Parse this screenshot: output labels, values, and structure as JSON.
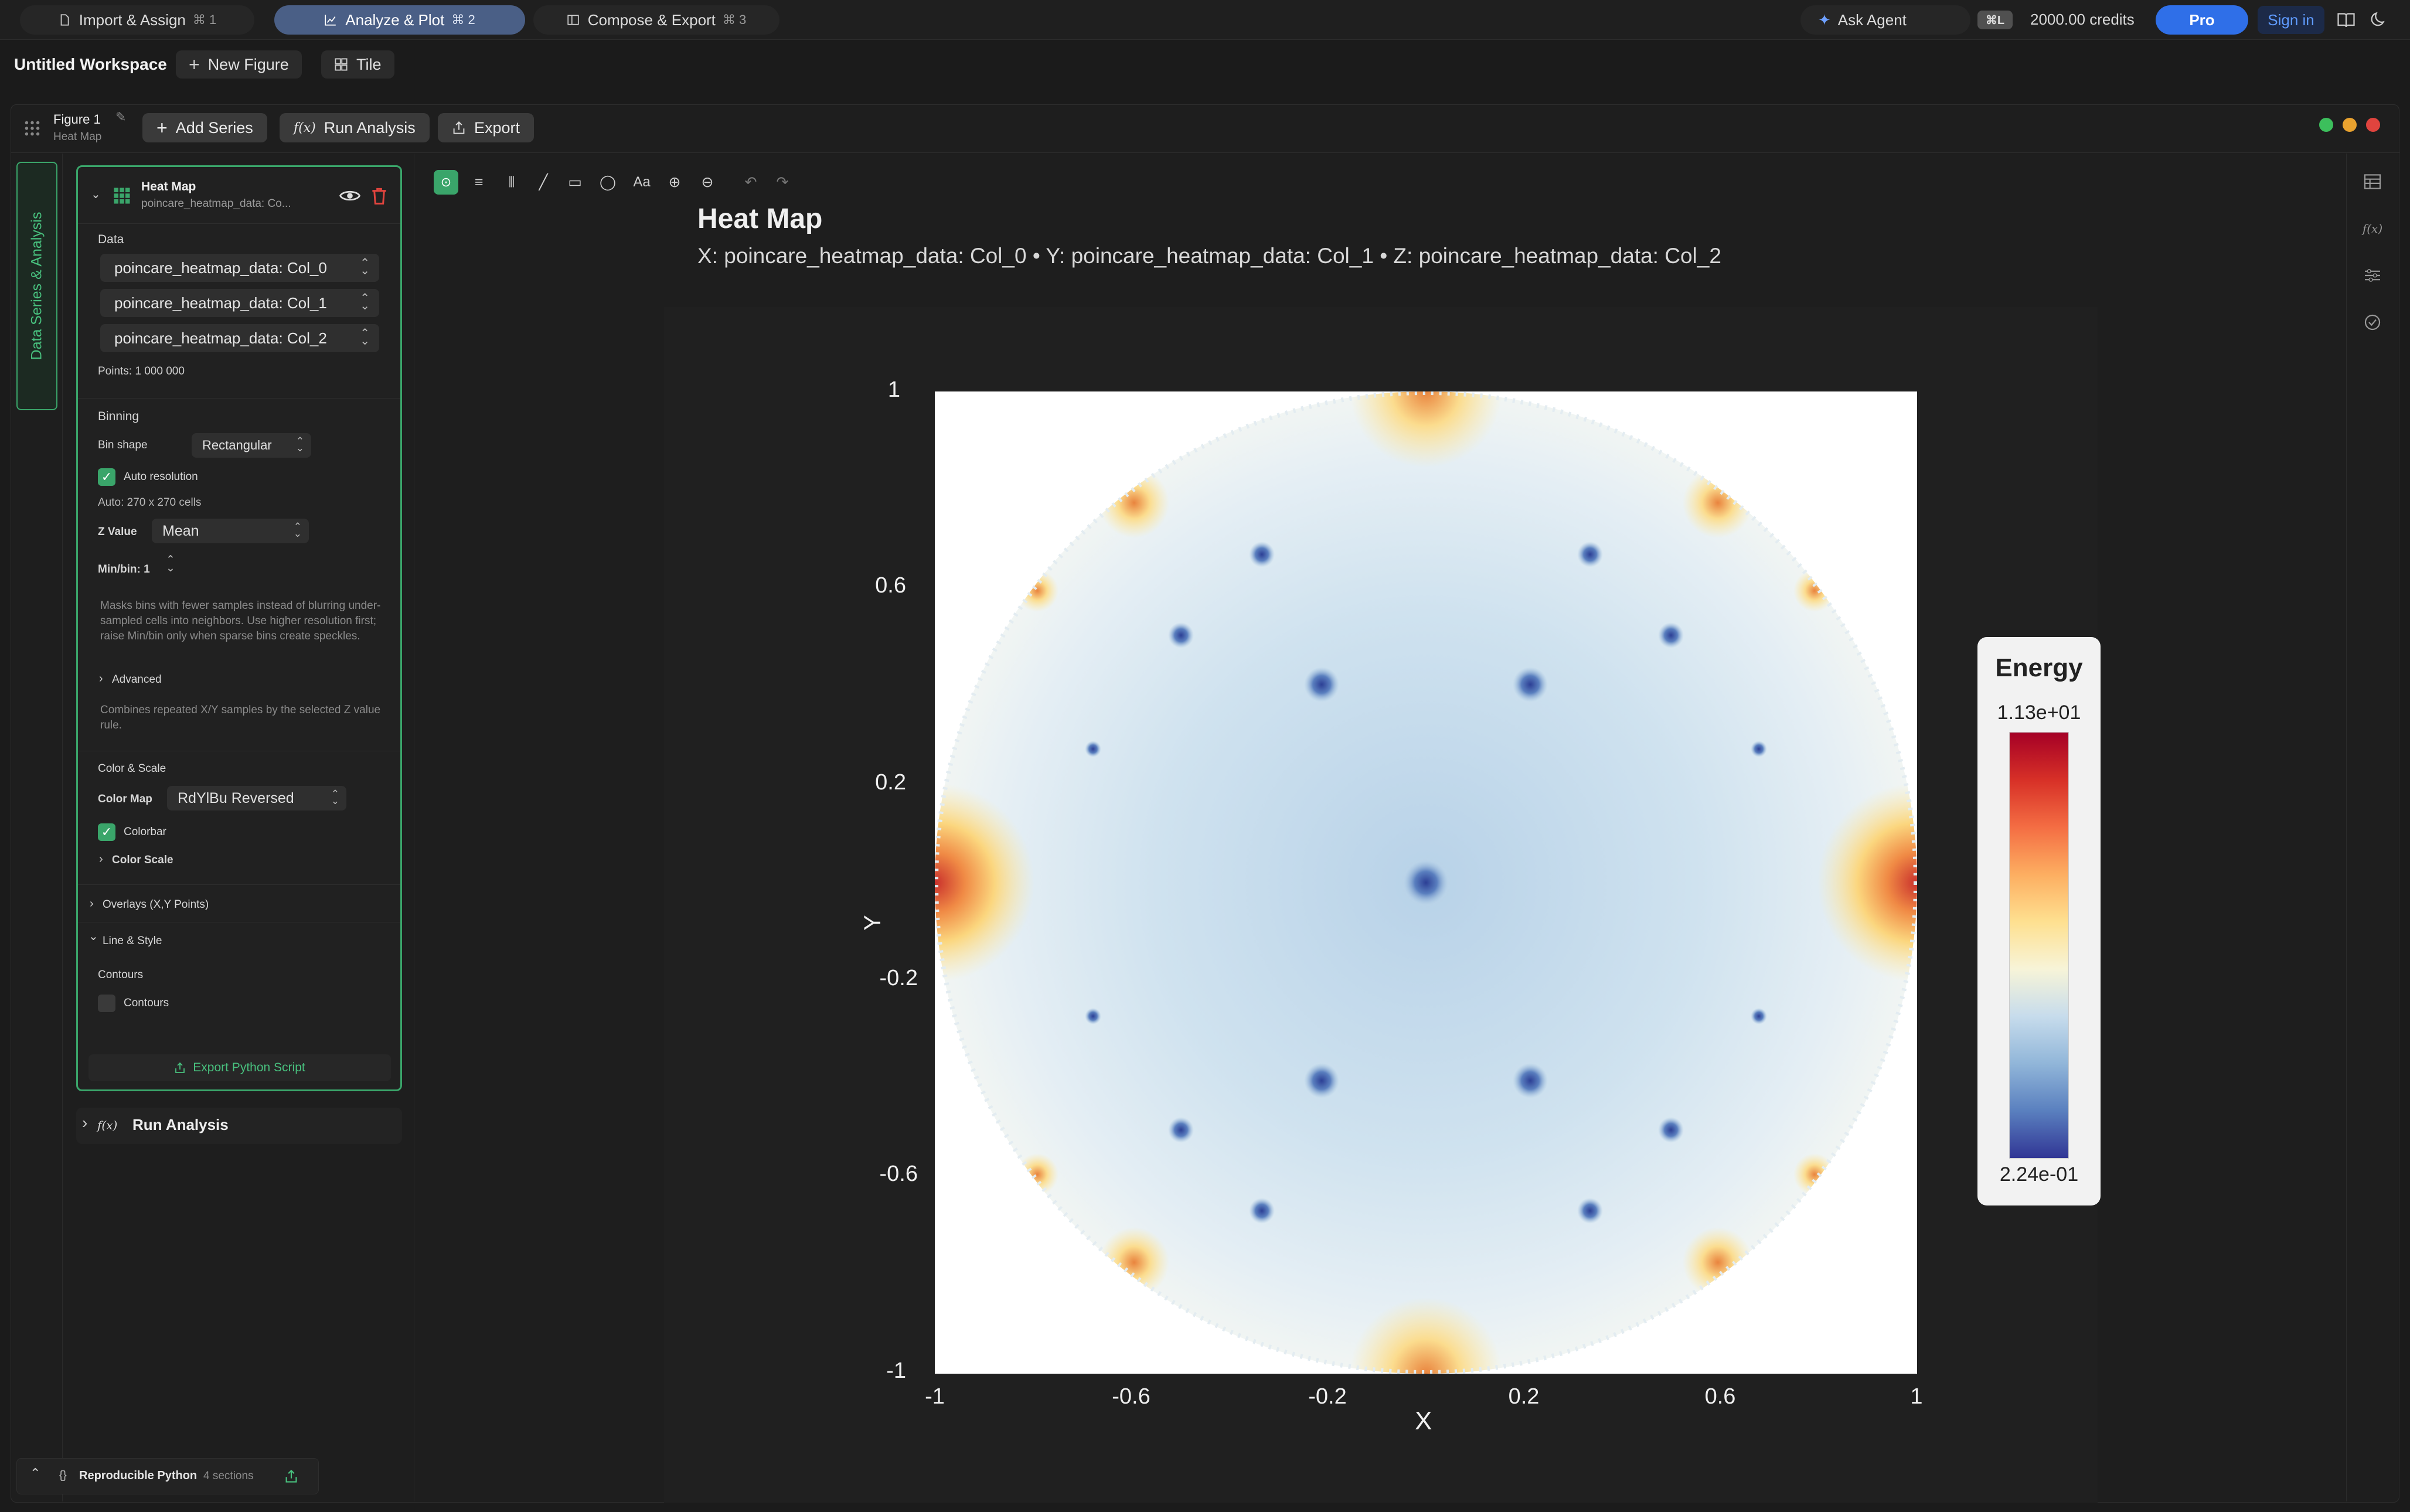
{
  "topbar": {
    "tabs": [
      {
        "label": "Import & Assign",
        "shortcut": "⌘ 1"
      },
      {
        "label": "Analyze & Plot",
        "shortcut": "⌘ 2"
      },
      {
        "label": "Compose & Export",
        "shortcut": "⌘ 3"
      }
    ],
    "ask_agent": "Ask Agent",
    "agent_shortcut": "⌘L",
    "credits": "2000.00 credits",
    "pro": "Pro",
    "sign_in": "Sign in"
  },
  "workspace": {
    "title": "Untitled Workspace",
    "new_figure": "New Figure",
    "tile": "Tile"
  },
  "figure": {
    "name": "Figure 1",
    "type": "Heat Map",
    "add_series": "Add Series",
    "run_analysis": "Run Analysis",
    "export": "Export",
    "fx": "f(x)"
  },
  "sidetab": "Data Series & Analysis",
  "panel": {
    "series_title": "Heat Map",
    "series_sub": "poincare_heatmap_data: Co...",
    "data_label": "Data",
    "cols": [
      "poincare_heatmap_data: Col_0",
      "poincare_heatmap_data: Col_1",
      "poincare_heatmap_data: Col_2"
    ],
    "points": "Points: 1 000 000",
    "binning": "Binning",
    "bin_shape_label": "Bin shape",
    "bin_shape": "Rectangular",
    "auto_res": "Auto resolution",
    "auto_cells": "Auto: 270 x 270 cells",
    "z_value_label": "Z Value",
    "z_value": "Mean",
    "minbin": "Min/bin: 1",
    "hint1": "Masks bins with fewer samples instead of blurring under-sampled cells into neighbors. Use higher resolution first; raise Min/bin only when sparse bins create speckles.",
    "advanced": "Advanced",
    "hint2": "Combines repeated X/Y samples by the selected Z value rule.",
    "color_scale_header": "Color & Scale",
    "color_map_label": "Color Map",
    "color_map": "RdYlBu Reversed",
    "colorbar": "Colorbar",
    "color_scale": "Color Scale",
    "overlays": "Overlays (X,Y Points)",
    "line_style": "Line & Style",
    "contours_header": "Contours",
    "contours": "Contours",
    "export_python": "Export Python Script",
    "run_analysis": "Run Analysis",
    "fx": "f(x)"
  },
  "bottom": {
    "repro": "Reproducible Python",
    "sections": "4 sections"
  },
  "plot": {
    "title": "Heat Map",
    "subtitle": "X: poincare_heatmap_data: Col_0 • Y: poincare_heatmap_data: Col_1 • Z: poincare_heatmap_data: Col_2",
    "draw_text_tool": "Aa"
  },
  "chart_data": {
    "type": "heatmap",
    "title": "Heat Map",
    "xlabel": "X",
    "ylabel": "Y",
    "xlim": [
      -1,
      1
    ],
    "ylim": [
      -1,
      1
    ],
    "xticks": [
      "-1",
      "-0.6",
      "-0.2",
      "0.2",
      "0.6",
      "1"
    ],
    "yticks": [
      "1",
      "0.6",
      "0.2",
      "-0.2",
      "-0.6",
      "-1"
    ],
    "colorbar": {
      "title": "Energy",
      "max": "1.13e+01",
      "min": "2.24e-01"
    },
    "colormap": "RdYlBu Reversed",
    "grid": false
  },
  "colors": {
    "accent": "#3aa56a",
    "active_tab": "#4a5f86",
    "pro": "#2f6fe8",
    "danger": "#d9463e"
  }
}
